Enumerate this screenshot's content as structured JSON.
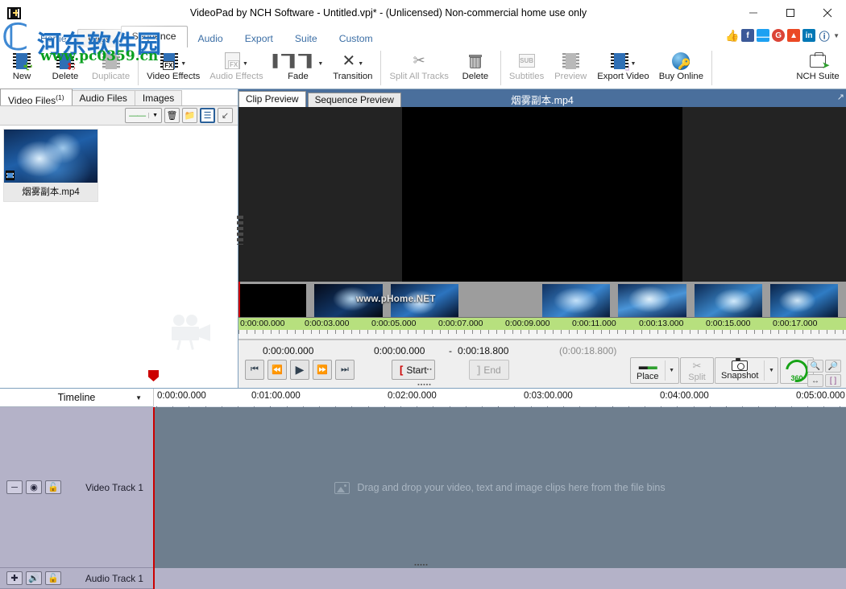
{
  "window": {
    "title": "VideoPad by NCH Software - Untitled.vpj* - (Unlicensed) Non-commercial home use only",
    "minimize": "─",
    "maximize": "□",
    "close": "✕"
  },
  "watermark": {
    "logo_char": "ℂ",
    "site_name": "河东软件园",
    "url": "www.pc0359.cn"
  },
  "ribbon": {
    "tabs": [
      {
        "label": "Home",
        "active": false
      },
      {
        "label": "Clips",
        "active": false
      },
      {
        "label": "Sequence",
        "active": true
      },
      {
        "label": "Audio",
        "active": false
      },
      {
        "label": "Export",
        "active": false
      },
      {
        "label": "Suite",
        "active": false
      },
      {
        "label": "Custom",
        "active": false
      }
    ],
    "social": [
      {
        "name": "thumbs-up-icon",
        "glyph": "👍"
      },
      {
        "name": "facebook-icon",
        "glyph": "f"
      },
      {
        "name": "twitter-icon",
        "glyph": "t"
      },
      {
        "name": "google-plus-icon",
        "glyph": "G+"
      },
      {
        "name": "stumbleupon-icon",
        "glyph": "su"
      },
      {
        "name": "linkedin-icon",
        "glyph": "in"
      },
      {
        "name": "help-icon",
        "glyph": "?"
      }
    ],
    "items": [
      {
        "label": "New",
        "enabled": true,
        "dropdown": false
      },
      {
        "label": "Delete",
        "enabled": true,
        "dropdown": false
      },
      {
        "label": "Duplicate",
        "enabled": false,
        "dropdown": false
      },
      {
        "label": "Video Effects",
        "enabled": true,
        "dropdown": true
      },
      {
        "label": "Audio Effects",
        "enabled": false,
        "dropdown": true
      },
      {
        "label": "Fade",
        "enabled": true,
        "dropdown": true
      },
      {
        "label": "Transition",
        "enabled": true,
        "dropdown": true
      },
      {
        "label": "Split All Tracks",
        "enabled": false,
        "dropdown": false
      },
      {
        "label": "Delete",
        "enabled": true,
        "dropdown": false
      },
      {
        "label": "Subtitles",
        "enabled": false,
        "dropdown": false
      },
      {
        "label": "Preview",
        "enabled": false,
        "dropdown": false
      },
      {
        "label": "Export Video",
        "enabled": true,
        "dropdown": true
      },
      {
        "label": "Buy Online",
        "enabled": true,
        "dropdown": false
      },
      {
        "label": "NCH Suite",
        "enabled": true,
        "dropdown": false
      }
    ]
  },
  "bin": {
    "tabs": [
      {
        "label": "Video Files",
        "count": "(1)",
        "active": true
      },
      {
        "label": "Audio Files",
        "count": "",
        "active": false
      },
      {
        "label": "Images",
        "count": "",
        "active": false
      }
    ],
    "tools": [
      {
        "name": "add-clip-dropdown",
        "glyph": "—"
      },
      {
        "name": "delete-bin-item-icon",
        "glyph": "🗑"
      },
      {
        "name": "add-folder-icon",
        "glyph": "📁"
      },
      {
        "name": "list-view-icon",
        "glyph": "☰"
      },
      {
        "name": "collapse-panel-icon",
        "glyph": "⤡"
      }
    ],
    "files": [
      {
        "name": "烟雾副本.mp4"
      }
    ]
  },
  "preview": {
    "tabs": [
      {
        "label": "Clip Preview",
        "active": true
      },
      {
        "label": "Sequence Preview",
        "active": false
      }
    ],
    "title": "烟雾副本.mp4",
    "expand_icon": "↗",
    "filmstrip_watermark": "www.pHome.NET",
    "ruler_labels": [
      "0:00:00.000",
      "0:00:03.000",
      "0:00:05.000",
      "0:00:07.000",
      "0:00:09.000",
      "0:00:11.000",
      "0:00:13.000",
      "0:00:15.000",
      "0:00:17.000"
    ],
    "transport": {
      "position": "0:00:00.000",
      "selection_start": "0:00:00.000",
      "selection_dash": "-",
      "selection_end": "0:00:18.800",
      "duration": "(0:00:18.800)",
      "buttons": [
        {
          "name": "skip-to-start-button",
          "glyph": "⏮",
          "enabled": true
        },
        {
          "name": "step-back-button",
          "glyph": "⏪",
          "enabled": false
        },
        {
          "name": "play-button",
          "glyph": "▶",
          "enabled": true
        },
        {
          "name": "step-forward-button",
          "glyph": "⏩",
          "enabled": true
        },
        {
          "name": "skip-to-end-button",
          "glyph": "⏭",
          "enabled": true
        }
      ],
      "start_label": "Start",
      "end_label": "End",
      "place_label": "Place",
      "split_label": "Split",
      "snapshot_label": "Snapshot",
      "rotate_label": "360",
      "zoom_buttons": [
        {
          "name": "zoom-out-icon",
          "glyph": "⊖"
        },
        {
          "name": "zoom-in-icon",
          "glyph": "⊕"
        },
        {
          "name": "fit-width-icon",
          "glyph": "↔"
        },
        {
          "name": "fit-selection-icon",
          "glyph": "[ ]"
        }
      ]
    }
  },
  "timeline": {
    "mode_label": "Timeline",
    "mode_caret": "▼",
    "ruler_labels": [
      "0:00:00.000",
      "0:01:00.000",
      "0:02:00.000",
      "0:03:00.000",
      "0:04:00.000",
      "0:05:00.000"
    ],
    "tracks": [
      {
        "name": "Video Track 1",
        "controls": [
          {
            "name": "collapse-track-icon",
            "glyph": "─"
          },
          {
            "name": "track-visibility-icon",
            "glyph": "◉"
          },
          {
            "name": "track-lock-icon",
            "glyph": "🔓"
          }
        ]
      },
      {
        "name": "Audio Track 1",
        "controls": [
          {
            "name": "add-track-icon",
            "glyph": "＋"
          },
          {
            "name": "track-mute-icon",
            "glyph": "🔊"
          },
          {
            "name": "track-lock-icon",
            "glyph": "🔓"
          }
        ]
      }
    ],
    "drop_hint": "Drag and drop your video, text and image clips here from the file bins",
    "grip": "▪▪▪▪▪"
  },
  "colors": {
    "title_bar": "#ffffff",
    "preview_header": "#4a6f9c",
    "preview_stage": "#232323",
    "filmstrip_ruler": "#b7e07e",
    "video_track_body": "#6e7e8e",
    "audio_track": "#b4b2c8",
    "playhead": "#cc0000"
  }
}
